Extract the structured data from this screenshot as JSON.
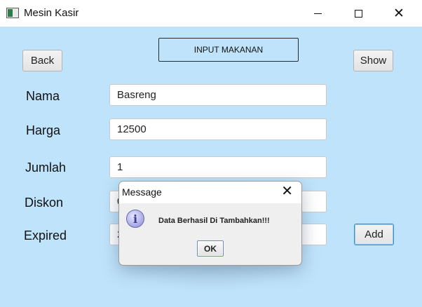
{
  "window": {
    "title": "Mesin Kasir",
    "controls": {
      "minimize_icon": "minimize-icon",
      "maximize_icon": "maximize-icon",
      "close_icon": "close-icon"
    }
  },
  "toolbar": {
    "back_label": "Back",
    "header_label": "INPUT MAKANAN",
    "show_label": "Show",
    "add_label": "Add"
  },
  "form": {
    "nama": {
      "label": "Nama",
      "value": "Basreng"
    },
    "harga": {
      "label": "Harga",
      "value": "12500"
    },
    "jumlah": {
      "label": "Jumlah",
      "value": "1"
    },
    "diskon": {
      "label": "Diskon",
      "value": "0"
    },
    "expired": {
      "label": "Expired",
      "value": "2"
    }
  },
  "dialog": {
    "title": "Message",
    "message": "Data Berhasil Di Tambahkan!!!",
    "ok_label": "OK",
    "icon": "info-icon"
  },
  "colors": {
    "background": "#bfe3fa",
    "add_border": "#3a8ed0"
  }
}
